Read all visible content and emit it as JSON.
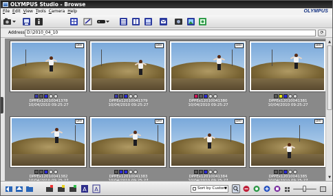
{
  "window": {
    "title_app": "OLYMPUS Studio",
    "title_sep": " - ",
    "title_view": "Browse"
  },
  "menu": {
    "items": [
      "File",
      "Edit",
      "View",
      "Tools",
      "Camera",
      "Help"
    ]
  },
  "logo": "OLYMPUS",
  "toolbar": {
    "icons": [
      "camera-dropdown-icon",
      "import-icon",
      "properties-icon",
      "lightbox-icon",
      "edit-image-icon",
      "slideshow-icon",
      "stack-icon",
      "compare-icon",
      "print-icon",
      "email-icon",
      "export-icon",
      "web-album-icon",
      "burn-disc-icon"
    ]
  },
  "address": {
    "label": "Address",
    "value": "D:\\2010_04_10",
    "go_symbol": "⟳"
  },
  "thumbnails": [
    {
      "badge": "ORF",
      "name": "DPPEx12010041378",
      "date": "10/04/2010 09:25:27",
      "label_colors": [
        "#3a3aa8",
        "#5a5a5a",
        "#2b2bd6"
      ]
    },
    {
      "badge": "ORF",
      "name": "DPPEx12010041379",
      "date": "10/04/2010 09:25:27",
      "label_colors": [
        "#3a3aa8",
        "#5a5a5a",
        "#2b2bd6"
      ]
    },
    {
      "badge": "ORF",
      "name": "DPPEx12010041380",
      "date": "10/04/2010 09:25:27",
      "label_colors": [
        "#d1155a",
        "#5a5a5a",
        "#2b2bd6"
      ]
    },
    {
      "badge": "ORF",
      "name": "DPPEx12010041381",
      "date": "10/04/2010 09:25:27",
      "label_colors": [
        "#5a5a5a",
        "#e3e314",
        "#2b2bd6"
      ]
    },
    {
      "badge": "ORF",
      "name": "DPPEx12010041382",
      "date": "10/04/2010 09:25:27",
      "label_colors": [
        "#5a5a5a",
        "#5a5a5a",
        "#2b2bd6"
      ]
    },
    {
      "badge": "ORF",
      "name": "DPPEx12010041383",
      "date": "10/04/2010 09:25:27",
      "label_colors": [
        "#5a5a5a",
        "#2b2bd6",
        "#2b2bd6"
      ]
    },
    {
      "badge": "ORF",
      "name": "DPPEx12010041384",
      "date": "10/04/2010 09:25:27",
      "label_colors": [
        "#5a5a5a",
        "#5a5a5a",
        "#2b2bd6"
      ]
    },
    {
      "badge": "ORF",
      "name": "DPPEx12010041385",
      "date": "10/04/2010 09:25:27",
      "label_colors": [
        "#5a5a5a",
        "#5a5a5a",
        "#2b2bd6"
      ]
    }
  ],
  "statusbar": {
    "sort_label": "Sort by Custom",
    "left_icons": [
      "back-folder-icon",
      "up-folder-icon",
      "folder-icon",
      "new-folder-icon",
      "tag-folder-icon",
      "flag-icon",
      "text-a-icon",
      "text-a-outline-icon"
    ],
    "right_icons": [
      "magnifier-icon",
      "zoom-out-icon",
      "zoom-fit-icon",
      "zoom-in-icon",
      "zoom-actual-icon",
      "grid-small-icon",
      "grid-large-icon"
    ]
  },
  "colors": {
    "content_bg": "#898989",
    "titlebar": "#1a1a1a",
    "accent": "#2b2bd6"
  }
}
